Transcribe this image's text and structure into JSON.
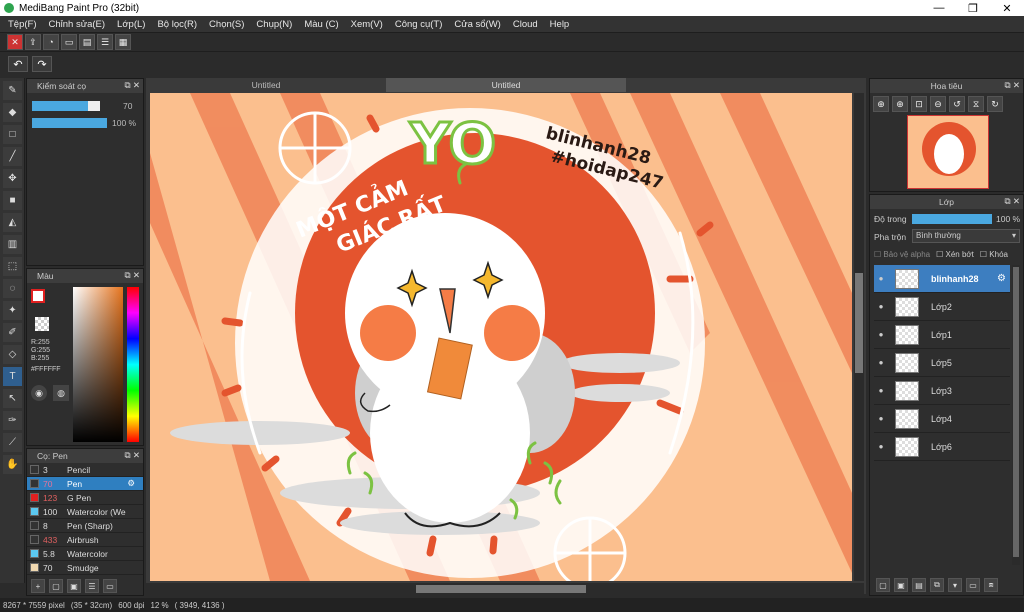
{
  "window": {
    "title": "MediBang Paint Pro (32bit)",
    "minimize": "—",
    "maximize": "❐",
    "close": "✕"
  },
  "menu": [
    "Tệp(F)",
    "Chỉnh sửa(E)",
    "Lớp(L)",
    "Bộ lọc(R)",
    "Chọn(S)",
    "Chụp(N)",
    "Màu (C)",
    "Xem(V)",
    "Công cụ(T)",
    "Cửa sổ(W)",
    "Cloud",
    "Help"
  ],
  "toolbar": {
    "undo": "↶",
    "redo": "↷"
  },
  "brush_control": {
    "title": "Kiểm soát cọ",
    "size_value": "70",
    "size_fill": 0.9,
    "opacity_value": "100 %",
    "opacity_fill": 1.0
  },
  "color_panel": {
    "title": "Màu",
    "rgb_r": "R:255",
    "rgb_g": "G:255",
    "rgb_b": "B:255",
    "hex": "#FFFFFF"
  },
  "brush_panel": {
    "title": "Cọ: Pen",
    "brushes": [
      {
        "size": "3",
        "name": "Pencil",
        "swatch": "#333333",
        "size_color": "#dddddd"
      },
      {
        "size": "70",
        "name": "Pen",
        "swatch": "#333333",
        "size_color": "#e6739a",
        "selected": true
      },
      {
        "size": "123",
        "name": "G Pen",
        "swatch": "#e02020",
        "size_color": "#e06060"
      },
      {
        "size": "100",
        "name": "Watercolor (We",
        "swatch": "#5bc8f0",
        "size_color": "#dddddd"
      },
      {
        "size": "8",
        "name": "Pen (Sharp)",
        "swatch": "#333333",
        "size_color": "#dddddd"
      },
      {
        "size": "433",
        "name": "Airbrush",
        "swatch": "#333333",
        "size_color": "#e06060"
      },
      {
        "size": "5.8",
        "name": "Watercolor",
        "swatch": "#5bc8f0",
        "size_color": "#dddddd"
      },
      {
        "size": "70",
        "name": "Smudge",
        "swatch": "#f0d8b0",
        "size_color": "#dddddd"
      }
    ]
  },
  "tabs": [
    "Untitled",
    "Untitled"
  ],
  "artwork": {
    "text_main_1": "MỘT CẢM",
    "text_main_2": "GIÁC RẤT",
    "text_yo": "YO",
    "signature_1": "blinhanh28",
    "signature_2": "#hoidap247",
    "colors": {
      "background": "#fbbf8e",
      "stripe": "#f0875a",
      "circle": "#e4542e",
      "cheek": "#f57c46"
    }
  },
  "navigator": {
    "title": "Hoa tiêu"
  },
  "layer_panel": {
    "title": "Lớp",
    "opacity_label": "Độ trong",
    "opacity_value": "100 %",
    "opacity_fill": 1.0,
    "blend_label": "Pha trộn",
    "blend_value": "Bình thường",
    "protect_alpha": "Bảo vệ alpha",
    "clipping": "Xén bớt",
    "lock": "Khóa",
    "layers": [
      {
        "name": "blinhanh28",
        "selected": true
      },
      {
        "name": "Lớp2"
      },
      {
        "name": "Lớp1"
      },
      {
        "name": "Lớp5"
      },
      {
        "name": "Lớp3"
      },
      {
        "name": "Lớp4"
      },
      {
        "name": "Lớp6"
      }
    ]
  },
  "status": {
    "size": "8267 * 7559 pixel",
    "cm": "(35 * 32cm)",
    "dpi": "600 dpi",
    "zoom": "12 %",
    "coords": "( 3949, 4136 )"
  }
}
